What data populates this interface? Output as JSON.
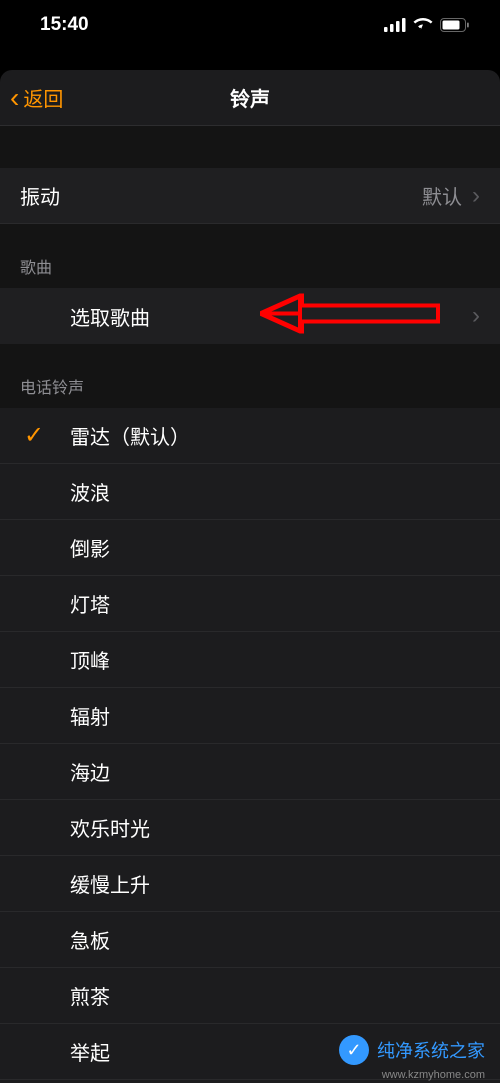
{
  "status": {
    "time": "15:40"
  },
  "nav": {
    "back_label": "返回",
    "title": "铃声"
  },
  "vibration": {
    "label": "振动",
    "value": "默认"
  },
  "sections": {
    "songs_header": "歌曲",
    "pick_song_label": "选取歌曲",
    "ringtones_header": "电话铃声"
  },
  "ringtones": {
    "selected_index": 0,
    "items": [
      "雷达（默认）",
      "波浪",
      "倒影",
      "灯塔",
      "顶峰",
      "辐射",
      "海边",
      "欢乐时光",
      "缓慢上升",
      "急板",
      "煎茶",
      "举起"
    ]
  },
  "watermark": {
    "text": "纯净系统之家",
    "url": "www.kzmyhome.com"
  }
}
